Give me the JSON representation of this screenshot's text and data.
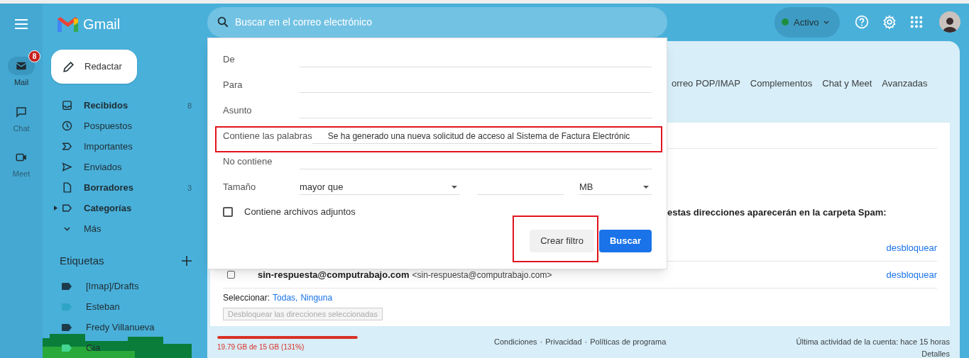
{
  "app": {
    "name": "Gmail"
  },
  "rail": [
    {
      "label": "Mail",
      "selected": true,
      "badge": "8"
    },
    {
      "label": "Chat",
      "selected": false
    },
    {
      "label": "Meet",
      "selected": false
    }
  ],
  "compose": {
    "label": "Redactar"
  },
  "sidebar": {
    "items": [
      {
        "label": "Recibidos",
        "bold": true,
        "count": "8"
      },
      {
        "label": "Pospuestos",
        "bold": false
      },
      {
        "label": "Importantes",
        "bold": false
      },
      {
        "label": "Enviados",
        "bold": false
      },
      {
        "label": "Borradores",
        "bold": true,
        "count": "3"
      },
      {
        "label": "Categorías",
        "bold": true,
        "expandable": true
      },
      {
        "label": "Más",
        "bold": false
      }
    ],
    "labels_heading": "Etiquetas",
    "labels": [
      {
        "label": "[Imap]/Drafts",
        "color": "#1c3a4a"
      },
      {
        "label": "Esteban",
        "color": "#2ea5c4"
      },
      {
        "label": "Fredy Villanueva",
        "color": "#1c3a4a"
      },
      {
        "label": "Gia",
        "color": "#43d692"
      }
    ]
  },
  "search": {
    "placeholder": "Buscar en el correo electrónico"
  },
  "status": {
    "label": "Activo",
    "color": "#1e8e3e"
  },
  "search_options": {
    "fields": [
      {
        "label": "De",
        "kind": "text"
      },
      {
        "label": "Para",
        "kind": "text"
      },
      {
        "label": "Asunto",
        "kind": "text"
      },
      {
        "label": "Contiene las palabras",
        "kind": "text",
        "value": "Se ha generado una nueva solicitud de acceso al Sistema de Factura Electrónic",
        "highlighted": true
      },
      {
        "label": "No contiene",
        "kind": "text"
      },
      {
        "label": "Tamaño",
        "kind": "size",
        "operator": "mayor que",
        "unit": "MB"
      }
    ],
    "attachments": {
      "label": "Contiene archivos adjuntos",
      "checked": false
    },
    "buttons": [
      {
        "label": "Crear filtro",
        "kind": "secondary",
        "highlighted": true
      },
      {
        "label": "Buscar",
        "kind": "primary",
        "highlighted": false
      }
    ]
  },
  "settings_tabs": [
    "orreo POP/IMAP",
    "Complementos",
    "Chat y Meet",
    "Avanzadas"
  ],
  "blocked": {
    "heading": "estas direcciones aparecerán en la carpeta Spam:",
    "rows": [
      {
        "action": "desbloquear"
      },
      {
        "name": "sin-respuesta@computrabajo.com",
        "address": "<sin-respuesta@computrabajo.com>",
        "checked": false,
        "action": "desbloquear"
      }
    ],
    "select_label": "Seleccionar:",
    "select_links": [
      "Todas",
      "Ninguna"
    ],
    "select_separator": ",",
    "unblock_button": "Desbloquear las direcciones seleccionadas"
  },
  "footer": {
    "storage": {
      "level": 1,
      "text": "19.79 GB de 15 GB (131%)"
    },
    "links": [
      "Condiciones",
      "Privacidad",
      "Políticas de programa"
    ],
    "separators": [
      "·",
      "·"
    ],
    "activity": "Última actividad de la cuenta: hace 15 horas",
    "details": "Detalles"
  }
}
